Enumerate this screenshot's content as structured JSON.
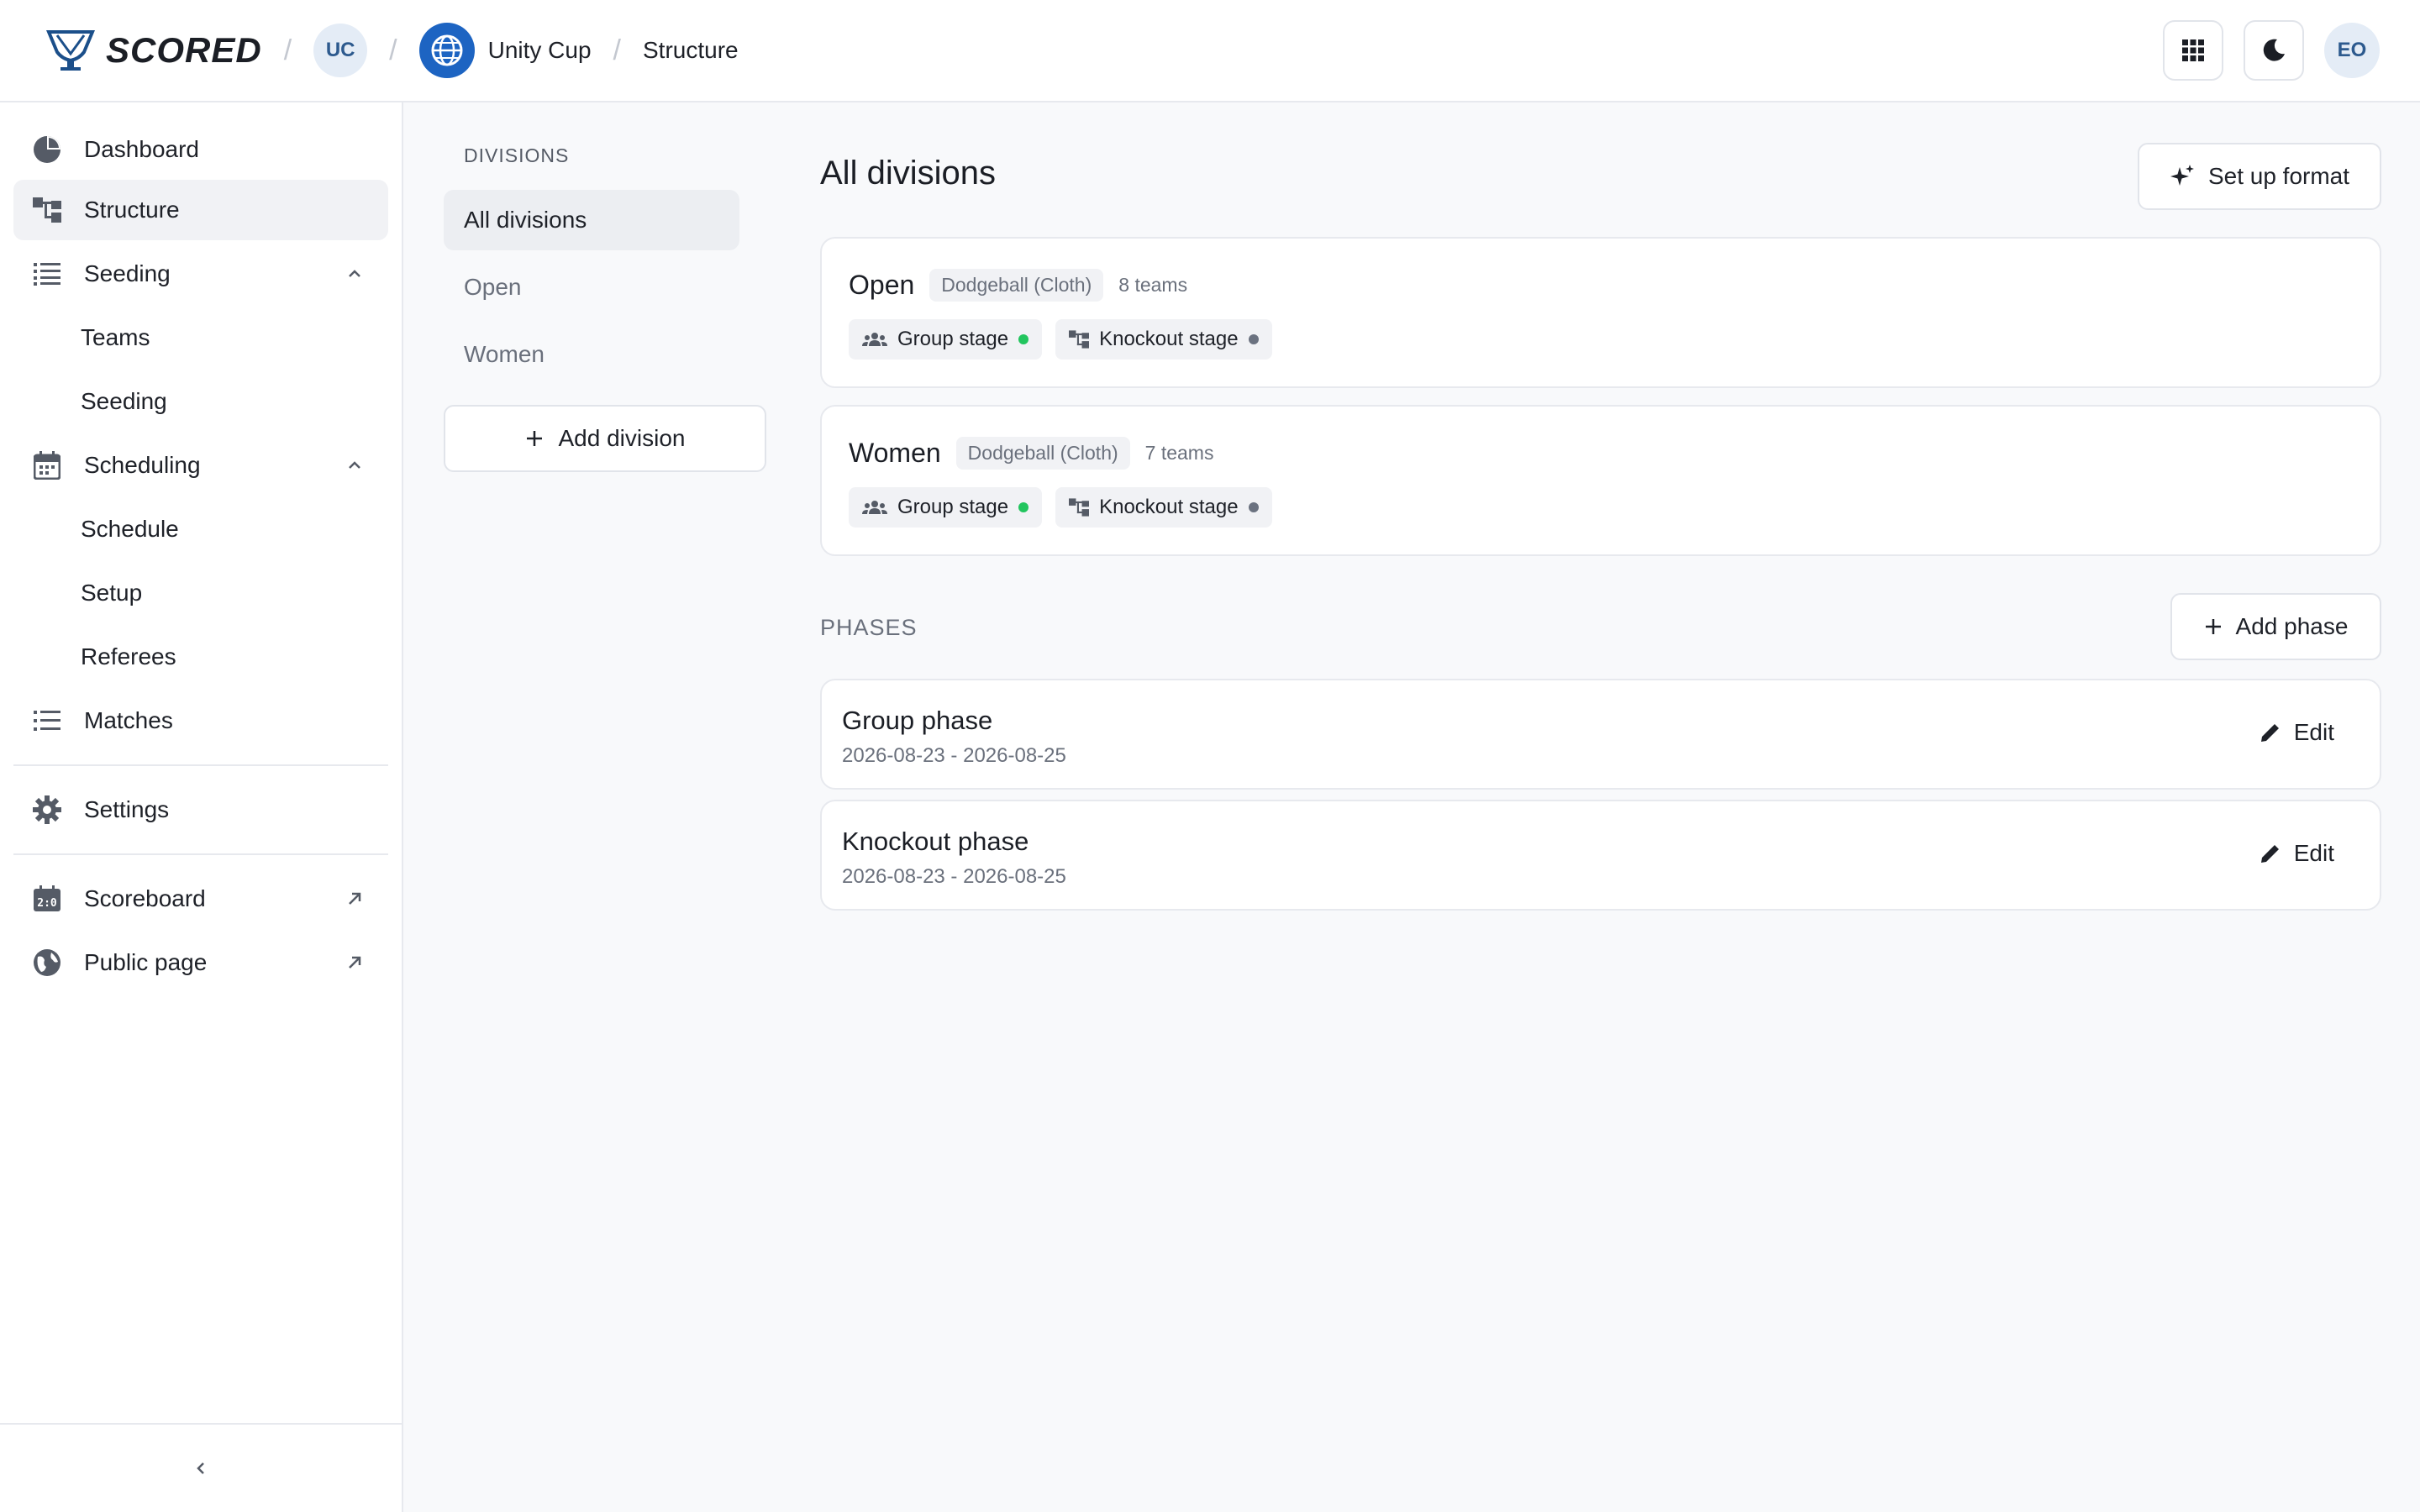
{
  "header": {
    "brand": "SCORED",
    "org_initials": "UC",
    "tournament": "Unity Cup",
    "page": "Structure",
    "user_initials": "EO"
  },
  "sidebar": {
    "dashboard": "Dashboard",
    "structure": "Structure",
    "seeding_group": "Seeding",
    "teams": "Teams",
    "seeding": "Seeding",
    "scheduling_group": "Scheduling",
    "schedule": "Schedule",
    "setup": "Setup",
    "referees": "Referees",
    "matches": "Matches",
    "settings": "Settings",
    "scoreboard": "Scoreboard",
    "public_page": "Public page"
  },
  "divisions_panel": {
    "label": "DIVISIONS",
    "items": [
      "All divisions",
      "Open",
      "Women"
    ],
    "add_label": "Add division"
  },
  "main": {
    "title": "All divisions",
    "setup_format_label": "Set up format",
    "divisions": [
      {
        "name": "Open",
        "sport": "Dodgeball (Cloth)",
        "teams": "8 teams",
        "stages": [
          {
            "label": "Group stage",
            "status_color": "#22c55e"
          },
          {
            "label": "Knockout stage",
            "status_color": "#6b7280"
          }
        ]
      },
      {
        "name": "Women",
        "sport": "Dodgeball (Cloth)",
        "teams": "7 teams",
        "stages": [
          {
            "label": "Group stage",
            "status_color": "#22c55e"
          },
          {
            "label": "Knockout stage",
            "status_color": "#6b7280"
          }
        ]
      }
    ],
    "phases_label": "PHASES",
    "add_phase_label": "Add phase",
    "phases": [
      {
        "name": "Group phase",
        "dates": "2026-08-23 - 2026-08-25",
        "edit_label": "Edit"
      },
      {
        "name": "Knockout phase",
        "dates": "2026-08-23 - 2026-08-25",
        "edit_label": "Edit"
      }
    ]
  }
}
